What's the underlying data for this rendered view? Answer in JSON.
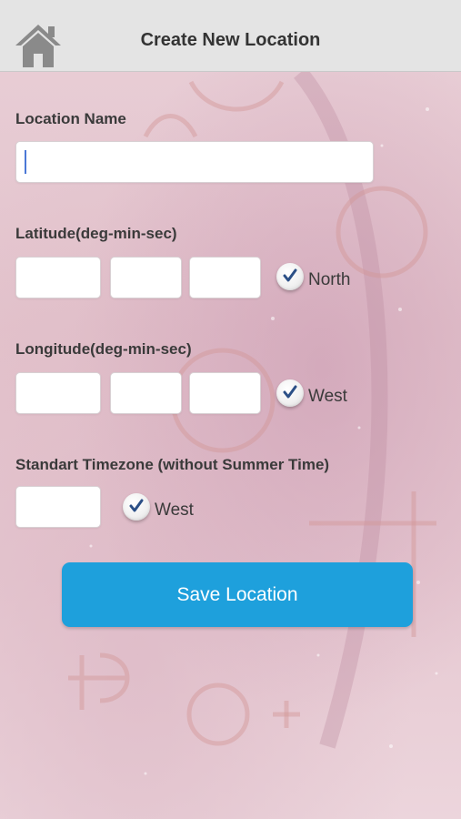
{
  "header": {
    "title": "Create New Location",
    "home_icon": "home-icon"
  },
  "location_name": {
    "label": "Location Name",
    "value": ""
  },
  "latitude": {
    "label": "Latitude(deg-min-sec)",
    "deg": "",
    "min": "",
    "sec": "",
    "direction_label": "North",
    "direction_checked": true
  },
  "longitude": {
    "label": "Longitude(deg-min-sec)",
    "deg": "",
    "min": "",
    "sec": "",
    "direction_label": "West",
    "direction_checked": true
  },
  "timezone": {
    "label": "Standart Timezone (without Summer Time)",
    "value": "",
    "direction_label": "West",
    "direction_checked": true
  },
  "actions": {
    "save_label": "Save Location"
  },
  "colors": {
    "accent": "#1ea0dc",
    "checkmark": "#2b4f86",
    "header_bg": "#e4e4e4"
  }
}
